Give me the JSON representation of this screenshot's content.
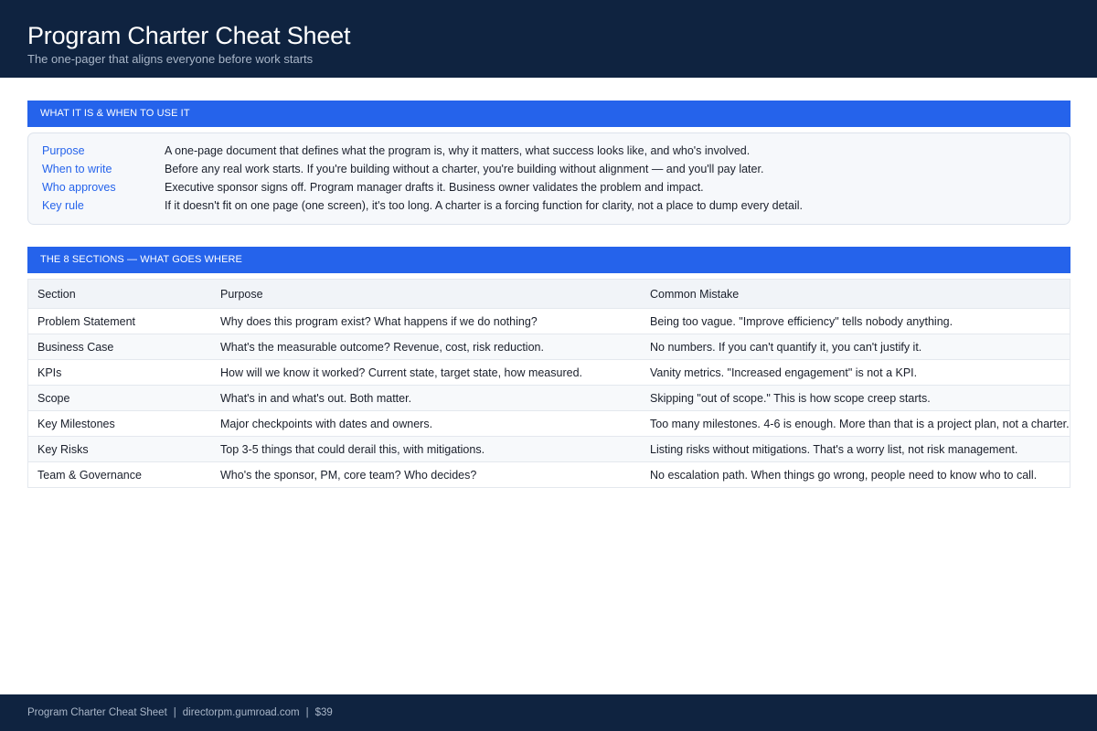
{
  "header": {
    "title": "Program Charter Cheat Sheet",
    "subtitle": "The one-pager that aligns everyone before work starts"
  },
  "section1": {
    "title": "WHAT IT IS & WHEN TO USE IT",
    "rows": [
      {
        "key": "Purpose",
        "value": "A one-page document that defines what the program is, why it matters, what success looks like, and who's involved."
      },
      {
        "key": "When to write",
        "value": "Before any real work starts. If you're building without a charter, you're building without alignment — and you'll pay later."
      },
      {
        "key": "Who approves",
        "value": "Executive sponsor signs off. Program manager drafts it. Business owner validates the problem and impact."
      },
      {
        "key": "Key rule",
        "value": "If it doesn't fit on one page (one screen), it's too long. A charter is a forcing function for clarity, not a place to dump every detail."
      }
    ]
  },
  "section2": {
    "title": "THE 8 SECTIONS — WHAT GOES WHERE",
    "columns": [
      "Section",
      "Purpose",
      "Common Mistake"
    ],
    "rows": [
      [
        "Problem Statement",
        "Why does this program exist? What happens if we do nothing?",
        "Being too vague. \"Improve efficiency\" tells nobody anything."
      ],
      [
        "Business Case",
        "What's the measurable outcome? Revenue, cost, risk reduction.",
        "No numbers. If you can't quantify it, you can't justify it."
      ],
      [
        "KPIs",
        "How will we know it worked? Current state, target state, how measured.",
        "Vanity metrics. \"Increased engagement\" is not a KPI."
      ],
      [
        "Scope",
        "What's in and what's out. Both matter.",
        "Skipping \"out of scope.\" This is how scope creep starts."
      ],
      [
        "Key Milestones",
        "Major checkpoints with dates and owners.",
        "Too many milestones. 4-6 is enough. More than that is a project plan, not a charter."
      ],
      [
        "Key Risks",
        "Top 3-5 things that could derail this, with mitigations.",
        "Listing risks without mitigations. That's a worry list, not risk management."
      ],
      [
        "Team & Governance",
        "Who's the sponsor, PM, core team? Who decides?",
        "No escalation path. When things go wrong, people need to know who to call."
      ]
    ]
  },
  "footer": {
    "title": "Program Charter Cheat Sheet",
    "separator": "|",
    "site": "directorpm.gumroad.com",
    "price": "$39"
  }
}
